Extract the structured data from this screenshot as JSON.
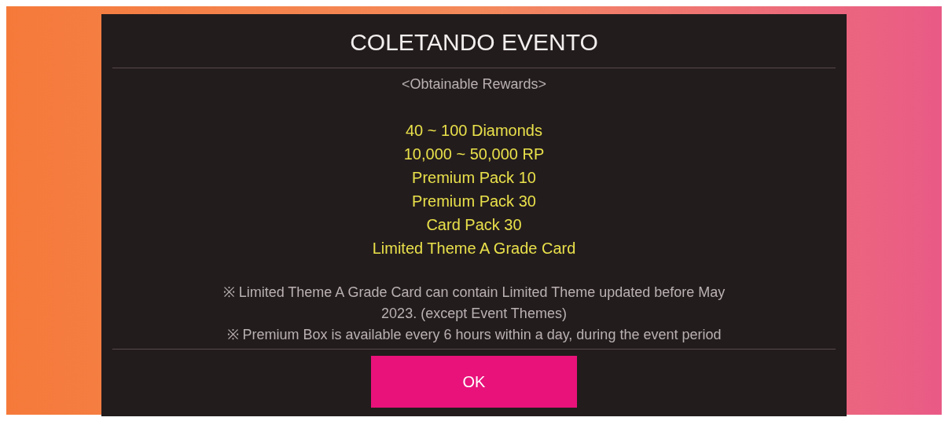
{
  "dialog": {
    "title": "COLETANDO EVENTO",
    "section_heading": "<Obtainable Rewards>",
    "rewards": [
      "40 ~ 100 Diamonds",
      "10,000 ~ 50,000 RP",
      "Premium Pack 10",
      "Premium Pack 30",
      "Card Pack 30",
      "Limited Theme A Grade Card"
    ],
    "notes": [
      "※ Limited Theme A Grade Card can contain Limited Theme updated before May 2023. (except Event Themes)",
      "※ Premium Box is available every 6 hours within a day, during the event period"
    ],
    "button": "OK"
  }
}
